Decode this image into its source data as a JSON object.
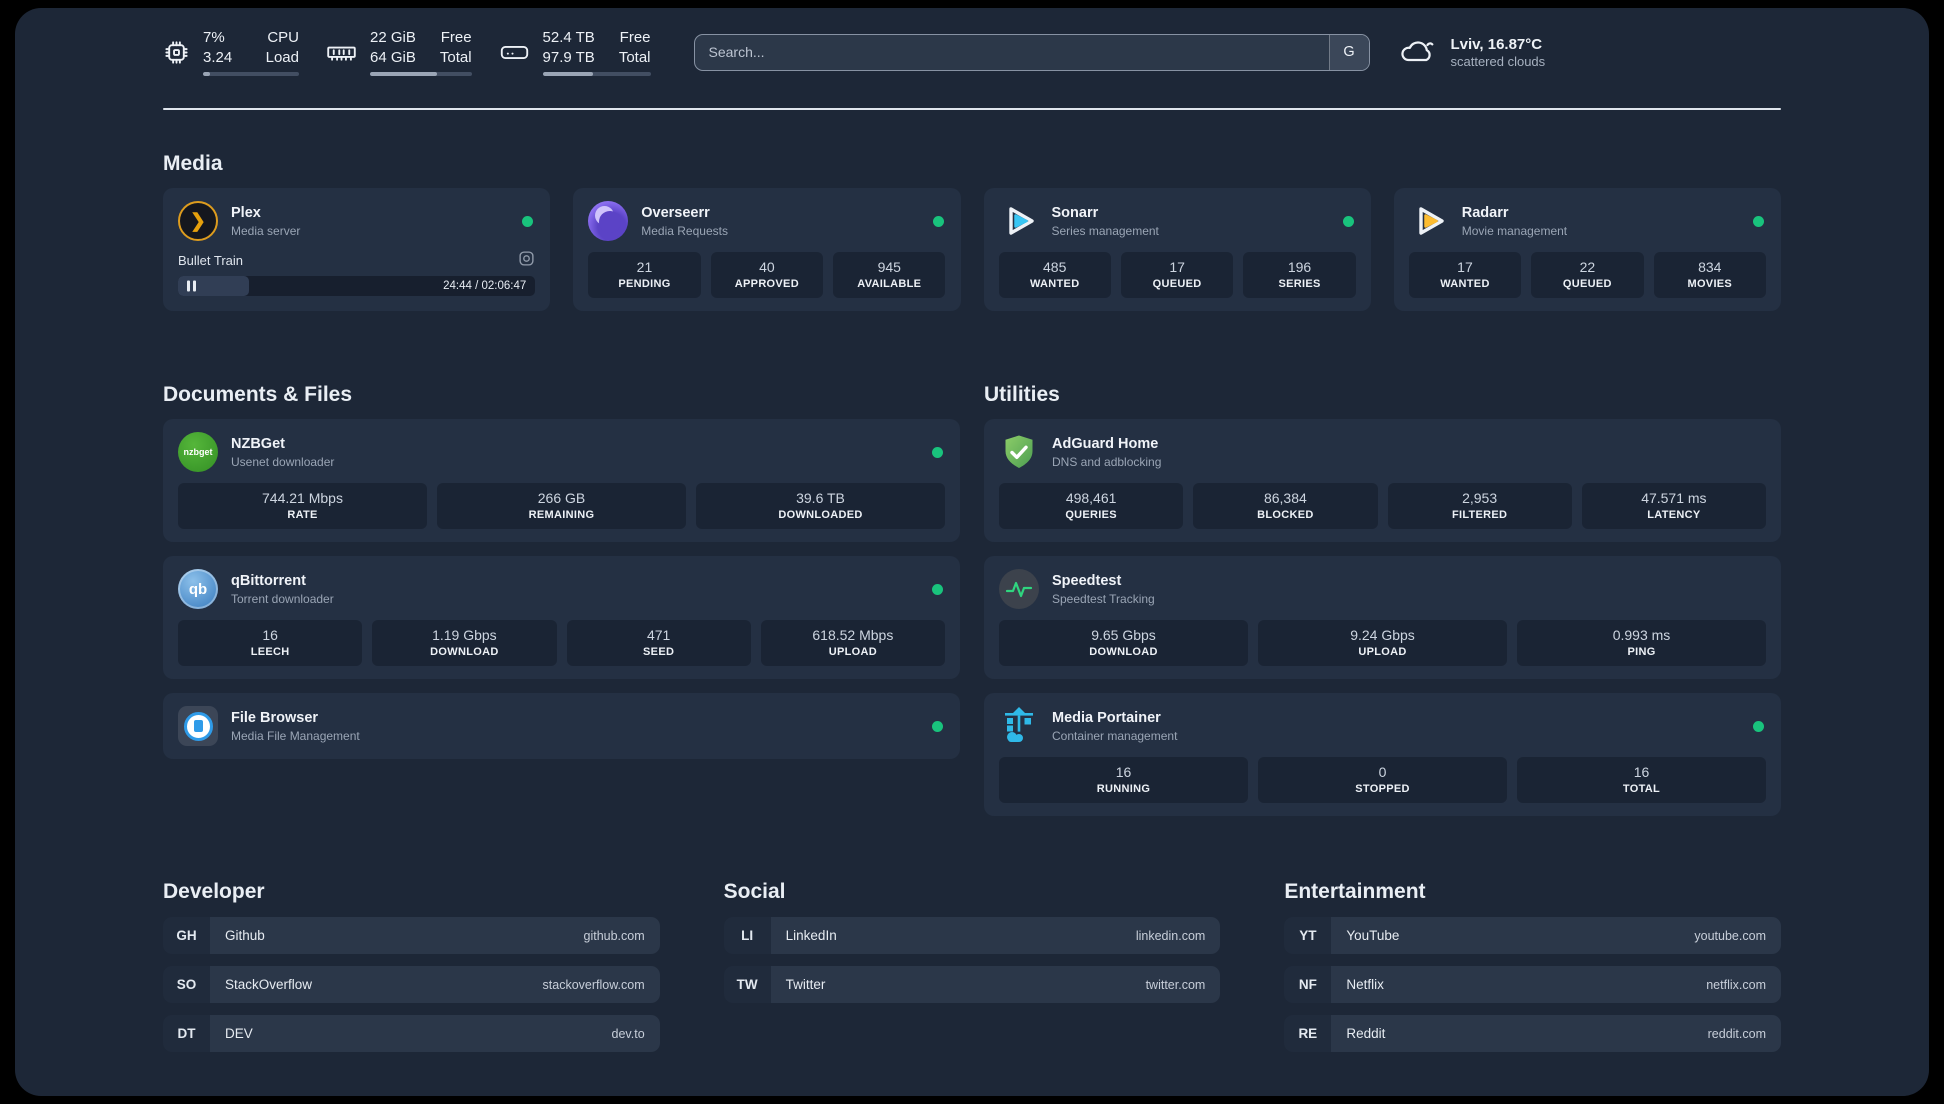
{
  "topbar": {
    "resources": [
      {
        "name": "cpu",
        "values": [
          "7%",
          "3.24"
        ],
        "labels": [
          "CPU",
          "Load"
        ],
        "bar_width": "7%"
      },
      {
        "name": "memory",
        "values": [
          "22 GiB",
          "64 GiB"
        ],
        "labels": [
          "Free",
          "Total"
        ],
        "bar_width": "66%"
      },
      {
        "name": "disk",
        "values": [
          "52.4 TB",
          "97.9 TB"
        ],
        "labels": [
          "Free",
          "Total"
        ],
        "bar_width": "47%"
      }
    ],
    "search": {
      "placeholder": "Search...",
      "provider": "G"
    },
    "weather": {
      "title": "Lviv, 16.87°C",
      "condition": "scattered clouds"
    }
  },
  "sections": {
    "media": {
      "title": "Media"
    },
    "documents": {
      "title": "Documents & Files"
    },
    "utilities": {
      "title": "Utilities"
    }
  },
  "apps": {
    "plex": {
      "name": "Plex",
      "desc": "Media server",
      "status": "online",
      "player": {
        "title": "Bullet Train",
        "state": "paused",
        "time": "24:44 / 02:06:47",
        "progress": "20%"
      }
    },
    "overseerr": {
      "name": "Overseerr",
      "desc": "Media Requests",
      "status": "online",
      "stats": [
        {
          "value": "21",
          "label": "PENDING"
        },
        {
          "value": "40",
          "label": "APPROVED"
        },
        {
          "value": "945",
          "label": "AVAILABLE"
        }
      ]
    },
    "sonarr": {
      "name": "Sonarr",
      "desc": "Series management",
      "status": "online",
      "stats": [
        {
          "value": "485",
          "label": "WANTED"
        },
        {
          "value": "17",
          "label": "QUEUED"
        },
        {
          "value": "196",
          "label": "SERIES"
        }
      ]
    },
    "radarr": {
      "name": "Radarr",
      "desc": "Movie management",
      "status": "online",
      "stats": [
        {
          "value": "17",
          "label": "WANTED"
        },
        {
          "value": "22",
          "label": "QUEUED"
        },
        {
          "value": "834",
          "label": "MOVIES"
        }
      ]
    },
    "nzbget": {
      "name": "NZBGet",
      "desc": "Usenet downloader",
      "status": "online",
      "icon_text": "nzbget",
      "stats": [
        {
          "value": "744.21 Mbps",
          "label": "RATE"
        },
        {
          "value": "266 GB",
          "label": "REMAINING"
        },
        {
          "value": "39.6 TB",
          "label": "DOWNLOADED"
        }
      ]
    },
    "qbittorrent": {
      "name": "qBittorrent",
      "desc": "Torrent downloader",
      "status": "online",
      "icon_text": "qb",
      "stats": [
        {
          "value": "16",
          "label": "LEECH"
        },
        {
          "value": "1.19 Gbps",
          "label": "DOWNLOAD"
        },
        {
          "value": "471",
          "label": "SEED"
        },
        {
          "value": "618.52 Mbps",
          "label": "UPLOAD"
        }
      ]
    },
    "filebrowser": {
      "name": "File Browser",
      "desc": "Media File Management",
      "status": "online"
    },
    "adguard": {
      "name": "AdGuard Home",
      "desc": "DNS and adblocking",
      "stats": [
        {
          "value": "498,461",
          "label": "QUERIES"
        },
        {
          "value": "86,384",
          "label": "BLOCKED"
        },
        {
          "value": "2,953",
          "label": "FILTERED"
        },
        {
          "value": "47.571 ms",
          "label": "LATENCY"
        }
      ]
    },
    "speedtest": {
      "name": "Speedtest",
      "desc": "Speedtest Tracking",
      "stats": [
        {
          "value": "9.65 Gbps",
          "label": "DOWNLOAD"
        },
        {
          "value": "9.24 Gbps",
          "label": "UPLOAD"
        },
        {
          "value": "0.993 ms",
          "label": "PING"
        }
      ]
    },
    "portainer": {
      "name": "Media Portainer",
      "desc": "Container management",
      "status": "online",
      "stats": [
        {
          "value": "16",
          "label": "RUNNING"
        },
        {
          "value": "0",
          "label": "STOPPED"
        },
        {
          "value": "16",
          "label": "TOTAL"
        }
      ]
    }
  },
  "bookmarks": [
    {
      "title": "Developer",
      "items": [
        {
          "abbr": "GH",
          "name": "Github",
          "url": "github.com"
        },
        {
          "abbr": "SO",
          "name": "StackOverflow",
          "url": "stackoverflow.com"
        },
        {
          "abbr": "DT",
          "name": "DEV",
          "url": "dev.to"
        }
      ]
    },
    {
      "title": "Social",
      "items": [
        {
          "abbr": "LI",
          "name": "LinkedIn",
          "url": "linkedin.com"
        },
        {
          "abbr": "TW",
          "name": "Twitter",
          "url": "twitter.com"
        }
      ]
    },
    {
      "title": "Entertainment",
      "items": [
        {
          "abbr": "YT",
          "name": "YouTube",
          "url": "youtube.com"
        },
        {
          "abbr": "NF",
          "name": "Netflix",
          "url": "netflix.com"
        },
        {
          "abbr": "RE",
          "name": "Reddit",
          "url": "reddit.com"
        }
      ]
    }
  ],
  "colors": {
    "status_online": "#19c37d",
    "plex_amber": "#e5a00d",
    "sonarr_cyan": "#38c6f4",
    "radarr_yellow": "#fcbc31",
    "adguard_green": "#6db864",
    "nzbget_green": "#3fa335",
    "qbittorrent_blue": "#4d8cc9",
    "portainer_blue": "#2fb9e8",
    "speedtest_pulse": "#2fd57f"
  }
}
